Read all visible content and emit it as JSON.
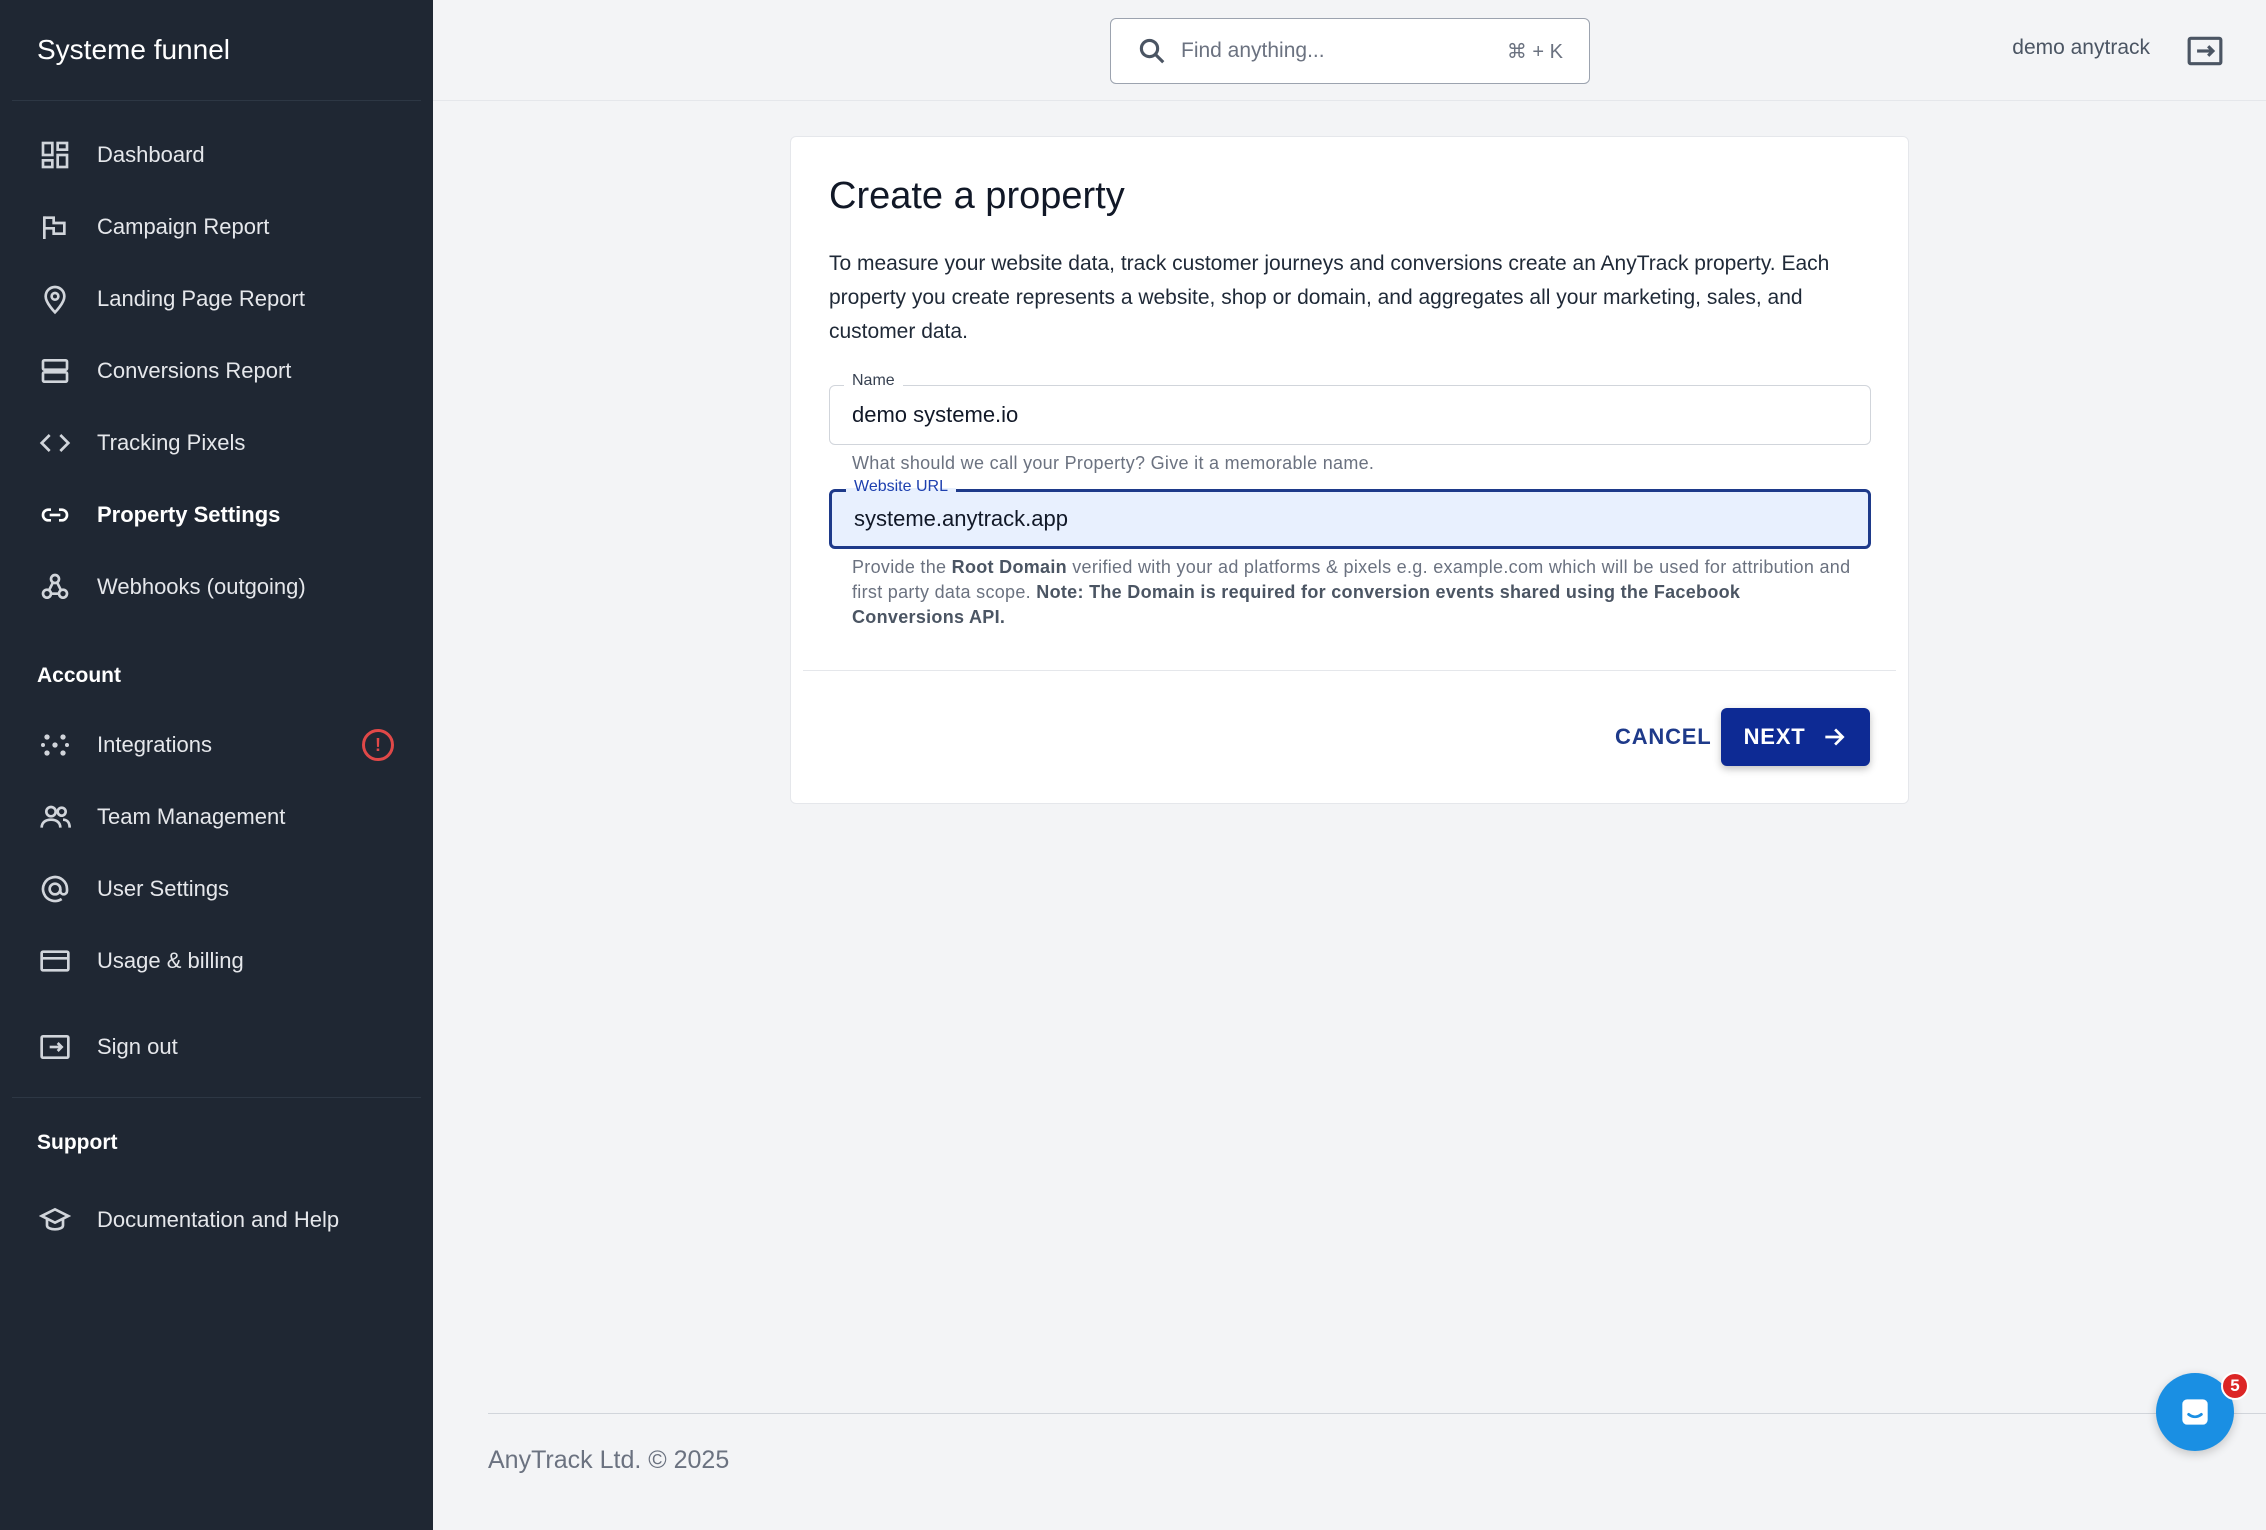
{
  "sidebar": {
    "brand": "Systeme funnel",
    "main_items": [
      {
        "label": "Dashboard",
        "icon": "dashboard-icon"
      },
      {
        "label": "Campaign Report",
        "icon": "flag-icon"
      },
      {
        "label": "Landing Page Report",
        "icon": "map-pin-icon"
      },
      {
        "label": "Conversions Report",
        "icon": "server-icon"
      },
      {
        "label": "Tracking Pixels",
        "icon": "code-icon"
      },
      {
        "label": "Property Settings",
        "icon": "link-icon",
        "active": true
      },
      {
        "label": "Webhooks (outgoing)",
        "icon": "webhook-icon"
      }
    ],
    "account_title": "Account",
    "account_items": [
      {
        "label": "Integrations",
        "icon": "integrations-icon",
        "alert": "!"
      },
      {
        "label": "Team Management",
        "icon": "users-icon"
      },
      {
        "label": "User Settings",
        "icon": "at-icon"
      },
      {
        "label": "Usage & billing",
        "icon": "credit-card-icon"
      }
    ],
    "signout_label": "Sign out",
    "support_title": "Support",
    "support_items": [
      {
        "label": "Documentation and Help",
        "icon": "graduation-cap-icon"
      }
    ]
  },
  "topbar": {
    "search_placeholder": "Find anything...",
    "search_shortcut": "⌘ + K",
    "user_name": "demo anytrack"
  },
  "form": {
    "title": "Create a property",
    "description": "To measure your website data, track customer journeys and conversions create an AnyTrack property. Each property you create represents a website, shop or domain, and aggregates all your marketing, sales, and customer data.",
    "name_label": "Name",
    "name_value": "demo systeme.io",
    "name_helper": "What should we call your Property? Give it a memorable name.",
    "url_label": "Website URL",
    "url_value": "systeme.anytrack.app",
    "url_helper_1": "Provide the ",
    "url_helper_bold_1": "Root Domain",
    "url_helper_2": " verified with your ad platforms & pixels e.g. example.com which will be used for attribution and first party data scope. ",
    "url_helper_bold_2": "Note: The Domain is required for conversion events shared using the Facebook Conversions API.",
    "cancel_label": "CANCEL",
    "next_label": "NEXT"
  },
  "footer": {
    "copyright": "AnyTrack Ltd. © 2025"
  },
  "chat": {
    "badge_count": "5"
  },
  "colors": {
    "sidebar_bg": "#1f2733",
    "primary": "#0d2a94",
    "alert": "#e04848",
    "chat": "#1a8fe3"
  }
}
